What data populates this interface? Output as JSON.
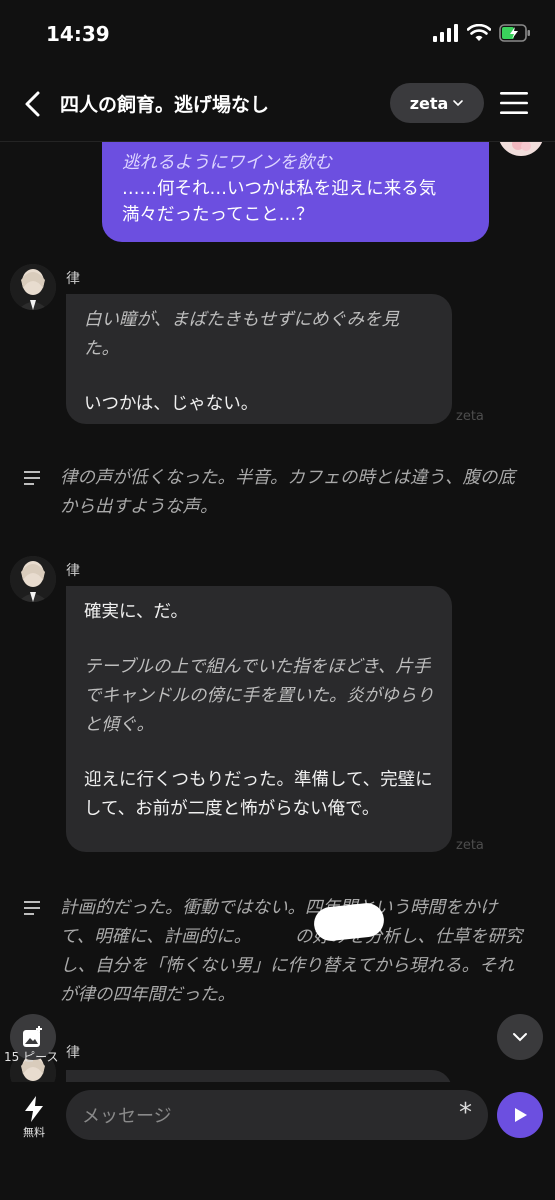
{
  "status": {
    "time": "14:39"
  },
  "header": {
    "title": "四人の飼育。逃げ場なし",
    "model": "zeta"
  },
  "messages": {
    "user": {
      "action": "逃れるようにワインを飲む",
      "text": "……何それ…いつかは私を迎えに来る気満々だったってこと…？"
    },
    "bot1": {
      "name": "律",
      "action": "白い瞳が、まばたきもせずにめぐみを見た。",
      "text": "いつかは、じゃない。",
      "watermark": "zeta"
    },
    "narration1": "律の声が低くなった。半音。カフェの時とは違う、腹の底から出すような声。",
    "bot2": {
      "name": "律",
      "text1": "確実に、だ。",
      "action": "テーブルの上で組んでいた指をほどき、片手でキャンドルの傍に手を置いた。炎がゆらりと傾ぐ。",
      "text2": "迎えに行くつもりだった。準備して、完璧にして、お前が二度と怖がらない俺で。",
      "watermark": "zeta"
    },
    "narration2": "計画的だった。衝動ではない。四年間という時間をかけて、明確に、計画的に。　　　の好みを分析し、仕草を研究し、自分を「怖くない男」に作り替えてから現れる。それが律の四年間だった。",
    "bot3": {
      "name": "律"
    }
  },
  "image_count": "15 ピース",
  "input": {
    "placeholder": "メッセージ",
    "free_label": "無料"
  },
  "colors": {
    "accent": "#6c4fe0",
    "background": "#111111",
    "bubble": "#2a2a2c"
  }
}
